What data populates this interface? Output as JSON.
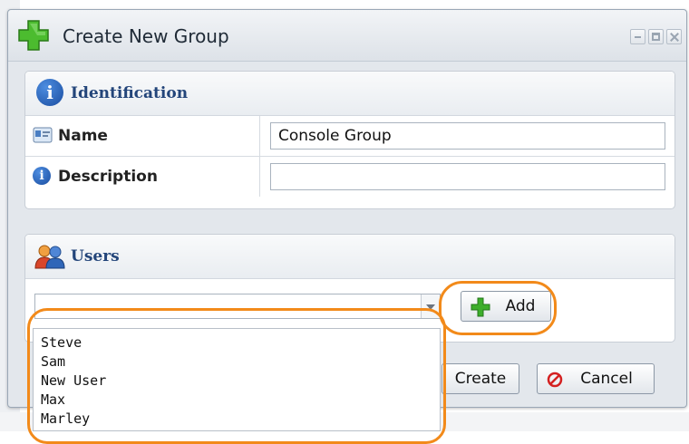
{
  "window": {
    "title": "Create New Group",
    "controls": [
      "minimize-icon",
      "maximize-icon",
      "close-icon"
    ]
  },
  "identification": {
    "title": "Identification",
    "fields": [
      {
        "label": "Name",
        "value": "Console Group",
        "icon": "name-card-icon"
      },
      {
        "label": "Description",
        "value": "",
        "icon": "info-icon"
      }
    ]
  },
  "users": {
    "title": "Users",
    "select_value": "",
    "add_label": "Add",
    "options": [
      "Steve",
      "Sam",
      "New User",
      "Max",
      "Marley"
    ]
  },
  "buttons": {
    "create_label": "Create",
    "cancel_label": "Cancel"
  },
  "colors": {
    "accent": "#23457a",
    "highlight": "#f28a1a",
    "add_green": "#3dae2b",
    "cancel_red": "#d42020"
  }
}
